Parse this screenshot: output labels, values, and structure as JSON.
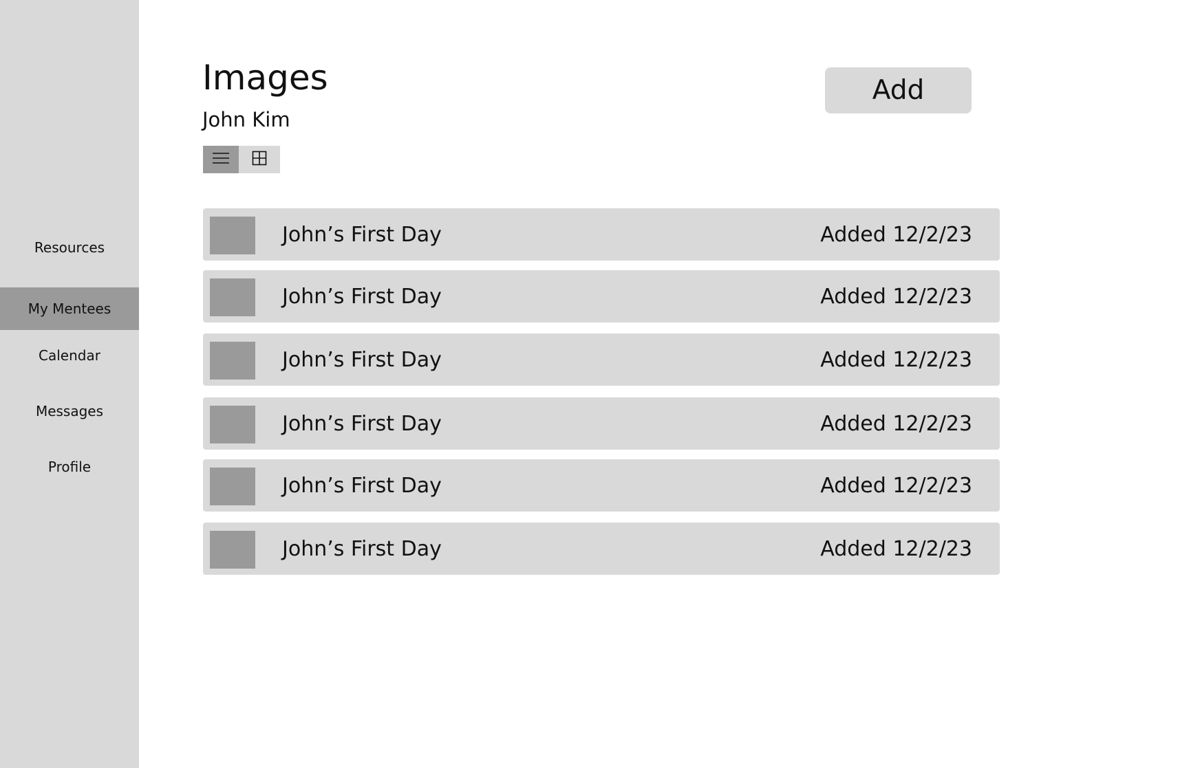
{
  "sidebar": {
    "items": [
      {
        "label": "Resources",
        "active": false
      },
      {
        "label": "My Mentees",
        "active": true
      },
      {
        "label": "Calendar",
        "active": false
      },
      {
        "label": "Messages",
        "active": false
      },
      {
        "label": "Profile",
        "active": false
      }
    ]
  },
  "header": {
    "title": "Images",
    "subtitle": "John Kim",
    "add_label": "Add"
  },
  "view_toggle": {
    "options": [
      {
        "icon": "list-view-icon",
        "selected": true
      },
      {
        "icon": "grid-view-icon",
        "selected": false
      }
    ]
  },
  "images": [
    {
      "title": "John’s First Day",
      "added": "Added 12/2/23"
    },
    {
      "title": "John’s First Day",
      "added": "Added 12/2/23"
    },
    {
      "title": "John’s First Day",
      "added": "Added 12/2/23"
    },
    {
      "title": "John’s First Day",
      "added": "Added 12/2/23"
    },
    {
      "title": "John’s First Day",
      "added": "Added 12/2/23"
    },
    {
      "title": "John’s First Day",
      "added": "Added 12/2/23"
    }
  ],
  "colors": {
    "panel": "#d9d9d9",
    "selected": "#9a9a9a",
    "background": "#ffffff",
    "text": "#111111"
  }
}
